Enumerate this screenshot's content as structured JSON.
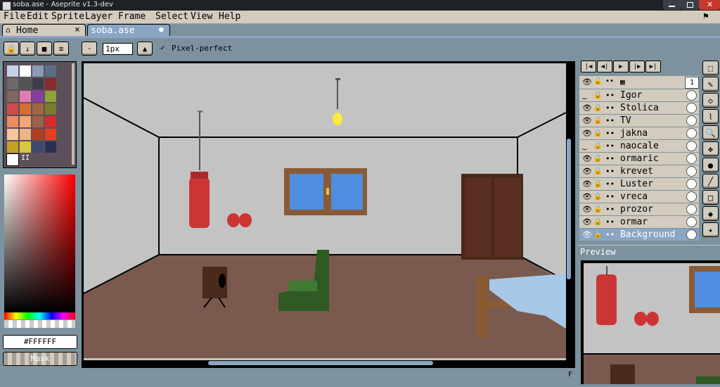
{
  "window": {
    "title": "soba.ase - Aseprite v1.3-dev"
  },
  "menu": [
    "File",
    "Edit",
    "Sprite",
    "Layer",
    "Frame",
    "Select",
    "View",
    "Help"
  ],
  "tabs": [
    {
      "label": "Home",
      "close": "×"
    },
    {
      "label": "soba.ase",
      "close": "●"
    }
  ],
  "context_bar": {
    "brush_size": "1px",
    "pixel_perfect_label": "Pixel-perfect",
    "pixel_perfect_checked": true
  },
  "palette": {
    "colors": [
      "#c4d3ea",
      "#ffffff",
      "#8b9bb4",
      "#5b6f84",
      "#6a6a6a",
      "#535353",
      "#3d3d4a",
      "#8a2a2a",
      "#7e6a60",
      "#e07cae",
      "#863ea1",
      "#8fa238",
      "#cc4d4d",
      "#d16f34",
      "#a06645",
      "#7b7b2e",
      "#ee8a64",
      "#f4a577",
      "#9a634a",
      "#d42c2c",
      "#f7c69e",
      "#f0b387",
      "#b04020",
      "#e83e1f",
      "#c2a024",
      "#d6c641",
      "#3e4870",
      "#2b2f54",
      "#ffffff"
    ],
    "selected_index": 28,
    "count_label": "II"
  },
  "color_picker": {
    "hex": "#FFFFFF",
    "mask_label": "Mask"
  },
  "canvas": {
    "wall_color": "#c3c3c3",
    "floor_color": "#7a5a4e"
  },
  "frame_label": "1",
  "layers": [
    {
      "name": "Igor",
      "visible": false
    },
    {
      "name": "Stolica",
      "visible": true
    },
    {
      "name": "TV",
      "visible": true
    },
    {
      "name": "jakna",
      "visible": true
    },
    {
      "name": "naocale",
      "visible": false
    },
    {
      "name": "ormaric",
      "visible": true
    },
    {
      "name": "krevet",
      "visible": true
    },
    {
      "name": "Luster",
      "visible": true
    },
    {
      "name": "vreca",
      "visible": true
    },
    {
      "name": "prozor",
      "visible": true
    },
    {
      "name": "ormar",
      "visible": true
    },
    {
      "name": "Background",
      "visible": true,
      "selected": true
    }
  ],
  "preview": {
    "title": "Preview"
  },
  "status": {
    "frame_indicator": "F"
  },
  "icons": {
    "lock": "lock-icon",
    "eye": "eye-icon",
    "link": "link-icon",
    "grid": "grid-icon",
    "brush": "brush-icon",
    "check": "check-icon"
  }
}
